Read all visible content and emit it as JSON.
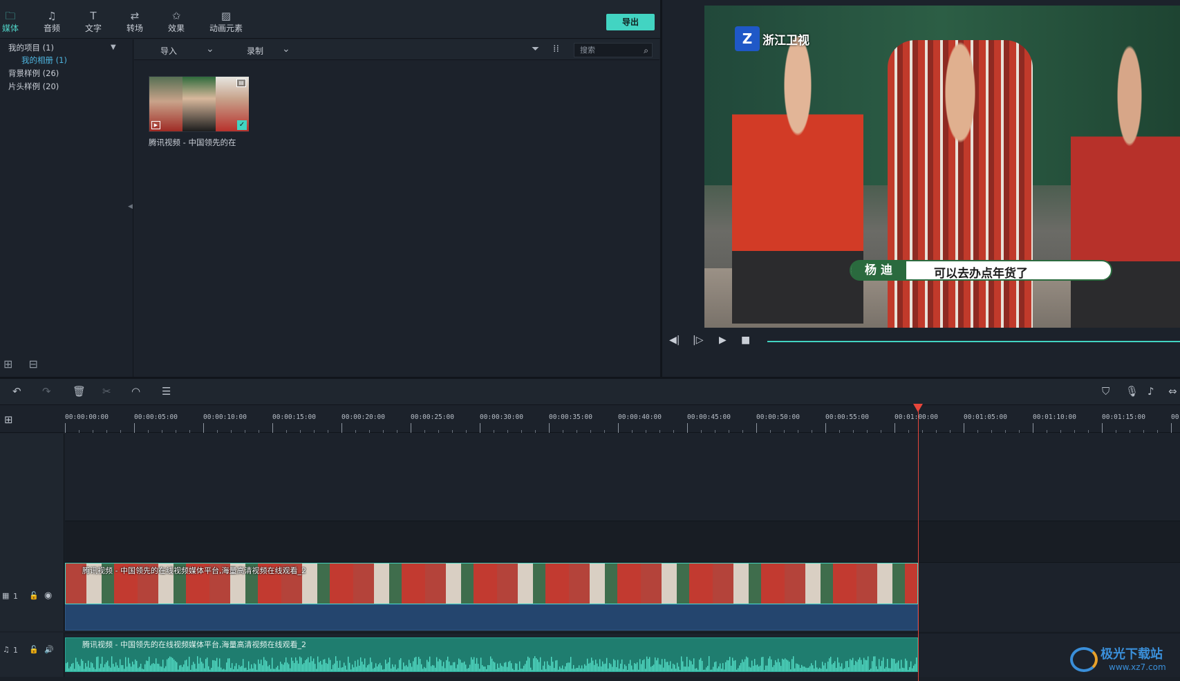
{
  "tabs": [
    {
      "label": "媒体",
      "icon": "folder-icon",
      "active": true
    },
    {
      "label": "音频",
      "icon": "music-note-icon",
      "active": false
    },
    {
      "label": "文字",
      "icon": "text-icon",
      "active": false
    },
    {
      "label": "转场",
      "icon": "transition-icon",
      "active": false
    },
    {
      "label": "效果",
      "icon": "effects-icon",
      "active": false
    },
    {
      "label": "动画元素",
      "icon": "image-icon",
      "active": false
    }
  ],
  "export_label": "导出",
  "library": {
    "items": [
      {
        "label": "我的项目 (1)"
      },
      {
        "label": "我的相册 (1)"
      },
      {
        "label": "背景样例 (26)"
      },
      {
        "label": "片头样例 (20)"
      }
    ]
  },
  "media_bar": {
    "import_label": "导入",
    "record_label": "录制",
    "search_placeholder": "搜索"
  },
  "media_item": {
    "label": "腾讯视频 - 中国领先的在"
  },
  "preview": {
    "station": "浙江卫视",
    "subtitle_name": "杨 迪",
    "subtitle_text": "可以去办点年货了"
  },
  "ruler": {
    "labels": [
      "00:00:00:00",
      "00:00:05:00",
      "00:00:10:00",
      "00:00:15:00",
      "00:00:20:00",
      "00:00:25:00",
      "00:00:30:00",
      "00:00:35:00",
      "00:00:40:00",
      "00:00:45:00",
      "00:00:50:00",
      "00:00:55:00",
      "00:01:00:00",
      "00:01:05:00",
      "00:01:10:00",
      "00:01:15:00",
      "00"
    ]
  },
  "tracks": {
    "video_track_num": "1",
    "audio_track_num": "1",
    "video_clip_title": "腾讯视频 - 中国领先的在线视频媒体平台,海量高清视频在线观看_2",
    "audio_clip_title": "腾讯视频 - 中国领先的在线视频媒体平台,海量高清视频在线观看_2"
  },
  "watermark": {
    "name": "极光下载站",
    "url": "www.xz7.com"
  },
  "colors": {
    "accent": "#42d4c2",
    "playhead": "#e8463b",
    "clip_blue": "#24456e"
  }
}
